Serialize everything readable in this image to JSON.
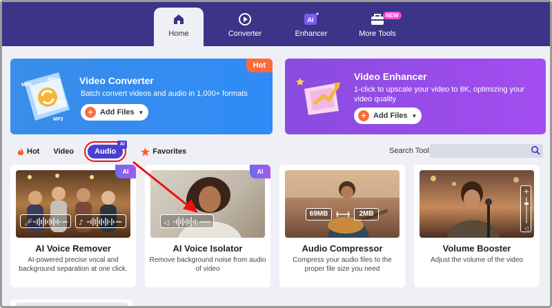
{
  "nav": {
    "tabs": [
      {
        "label": "Home",
        "icon": "home-icon",
        "active": true
      },
      {
        "label": "Converter",
        "icon": "converter-icon",
        "active": false
      },
      {
        "label": "Enhancer",
        "icon": "ai-enhancer-icon",
        "active": false
      },
      {
        "label": "More Tools",
        "icon": "toolbox-icon",
        "active": false,
        "badge": "NEW"
      }
    ]
  },
  "banners": {
    "converter": {
      "title": "Video Converter",
      "desc": "Batch convert videos and audio in 1,000+ formats",
      "button": "Add Files",
      "tag": "Hot",
      "formats": [
        "MP4",
        "AVI",
        "MOV",
        "MP3"
      ]
    },
    "enhancer": {
      "title": "Video Enhancer",
      "desc": "1-click to upscale your video to 8K, optimizing your video quality",
      "button": "Add Files"
    }
  },
  "filters": {
    "tabs": [
      "Hot",
      "Video",
      "Audio",
      "Favorites"
    ],
    "active": "Audio",
    "search_label": "Search Tool:",
    "search_value": ""
  },
  "cards": [
    {
      "title": "AI Voice Remover",
      "desc": "AI-powered precise vocal and background separation at one click.",
      "ai": "AI"
    },
    {
      "title": "AI Voice Isolator",
      "desc": "Remove background noise from audio of video",
      "ai": "AI"
    },
    {
      "title": "Audio Compressor",
      "desc": "Compress your audio files to the proper file size you need",
      "from": "69MB",
      "to": "2MB"
    },
    {
      "title": "Volume Booster",
      "desc": "Adjust the volume of the video"
    }
  ],
  "colors": {
    "nav_bg": "#3b3487",
    "accent": "#4a3fd0",
    "hot": "#ff6a3d",
    "highlight": "#e11111"
  }
}
